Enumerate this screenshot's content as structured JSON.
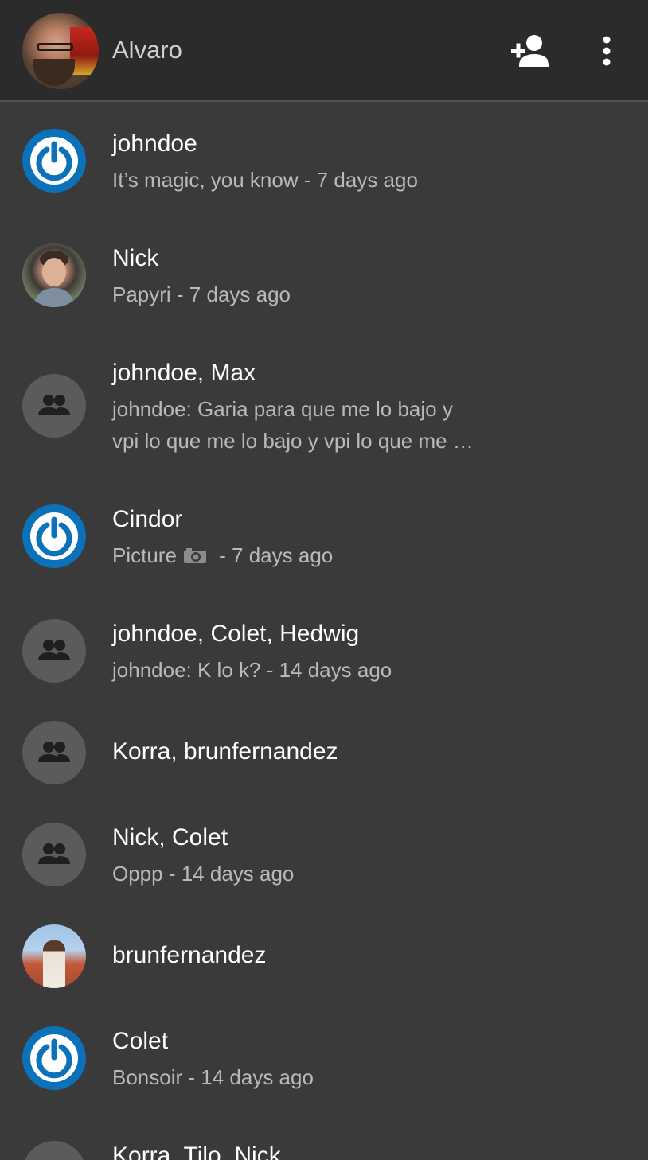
{
  "header": {
    "username": "Alvaro"
  },
  "conversations": [
    {
      "title": "johndoe",
      "subtitle": "It’s magic, you know - 7 days ago"
    },
    {
      "title": "Nick",
      "subtitle": "Papyri - 7 days ago"
    },
    {
      "title": "johndoe, Max",
      "subtitle_line1": "johndoe: Garia para que me lo bajo y",
      "subtitle_line2": "vpi lo que me lo bajo y vpi lo que me …"
    },
    {
      "title": "Cindor",
      "subtitle_prefix": "Picture",
      "subtitle_suffix": " - 7 days ago"
    },
    {
      "title": "johndoe, Colet, Hedwig",
      "subtitle": "johndoe: K lo k? - 14 days ago"
    },
    {
      "title": "Korra, brunfernandez"
    },
    {
      "title": "Nick, Colet",
      "subtitle": "Oppp - 14 days ago"
    },
    {
      "title": "brunfernandez"
    },
    {
      "title": "Colet",
      "subtitle": "Bonsoir - 14 days ago"
    },
    {
      "title": "Korra, Tilo, Nick"
    }
  ],
  "colors": {
    "background": "#3a3a3b",
    "header": "#2b2b2c",
    "accent_blue": "#0b72b9",
    "group_avatar": "#5b5b5c"
  }
}
